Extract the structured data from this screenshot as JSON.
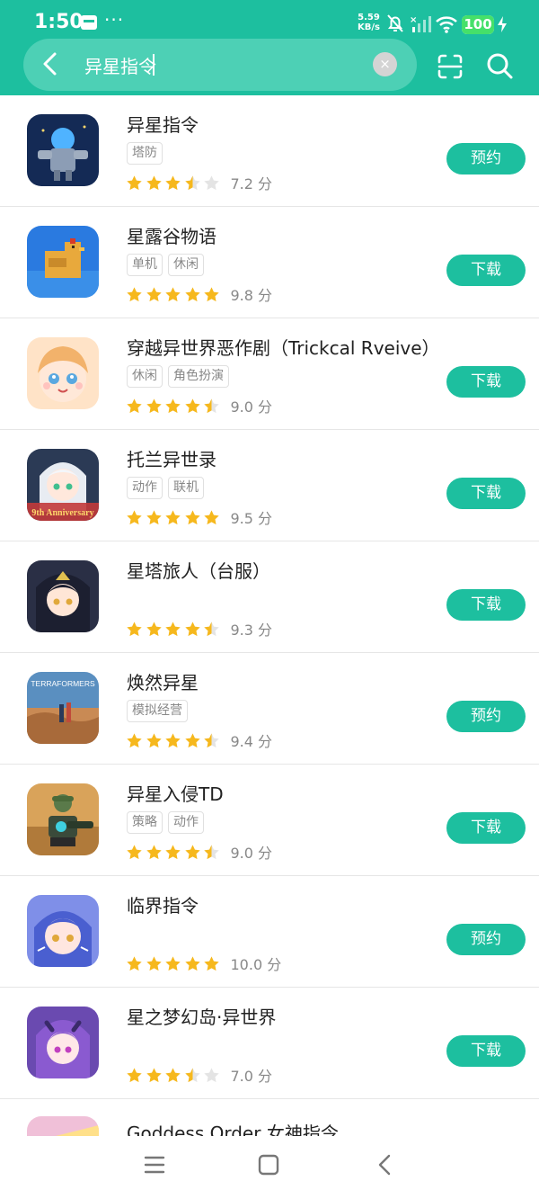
{
  "status_bar": {
    "time": "1:50",
    "more": "···",
    "net_speed_value": "5.59",
    "net_speed_unit": "KB/s",
    "battery": "100"
  },
  "search": {
    "query": "异星指令",
    "clear_label": "×"
  },
  "colors": {
    "accent": "#1dbf9f",
    "star": "#f6b81d",
    "star_empty": "#e4e4e4"
  },
  "apps": [
    {
      "name": "异星指令",
      "tags": [
        "塔防"
      ],
      "rating": 3.5,
      "score": "7.2 分",
      "action": "预约",
      "icon": "alien-command-game-icon"
    },
    {
      "name": "星露谷物语",
      "tags": [
        "单机",
        "休闲"
      ],
      "rating": 5,
      "score": "9.8 分",
      "action": "下载",
      "icon": "stardew-chicken-game-icon"
    },
    {
      "name": "穿越异世界恶作剧（Trickcal Rveive）",
      "tags": [
        "休闲",
        "角色扮演"
      ],
      "rating": 4.5,
      "score": "9.0 分",
      "action": "下载",
      "icon": "trickcal-game-icon"
    },
    {
      "name": "托兰异世录",
      "tags": [
        "动作",
        "联机"
      ],
      "rating": 5,
      "score": "9.5 分",
      "action": "下载",
      "icon": "tolan-anime-game-icon",
      "icon_text": "9th Anniversary"
    },
    {
      "name": "星塔旅人（台服）",
      "tags": [],
      "rating": 4.5,
      "score": "9.3 分",
      "action": "下载",
      "icon": "star-tower-game-icon"
    },
    {
      "name": "焕然异星",
      "tags": [
        "模拟经营"
      ],
      "rating": 4.5,
      "score": "9.4 分",
      "action": "预约",
      "icon": "terraformers-game-icon",
      "icon_text": "TERRAFORMERS"
    },
    {
      "name": "异星入侵TD",
      "tags": [
        "策略",
        "动作"
      ],
      "rating": 4.5,
      "score": "9.0 分",
      "action": "下载",
      "icon": "alien-invasion-td-game-icon"
    },
    {
      "name": "临界指令",
      "tags": [],
      "rating": 5,
      "score": "10.0 分",
      "action": "预约",
      "icon": "critical-command-game-icon"
    },
    {
      "name": "星之梦幻岛·异世界",
      "tags": [],
      "rating": 3.5,
      "score": "7.0 分",
      "action": "下载",
      "icon": "star-dream-island-game-icon"
    }
  ],
  "partial_app": {
    "name": "Goddess Order 女神指令",
    "icon": "goddess-order-game-icon"
  }
}
